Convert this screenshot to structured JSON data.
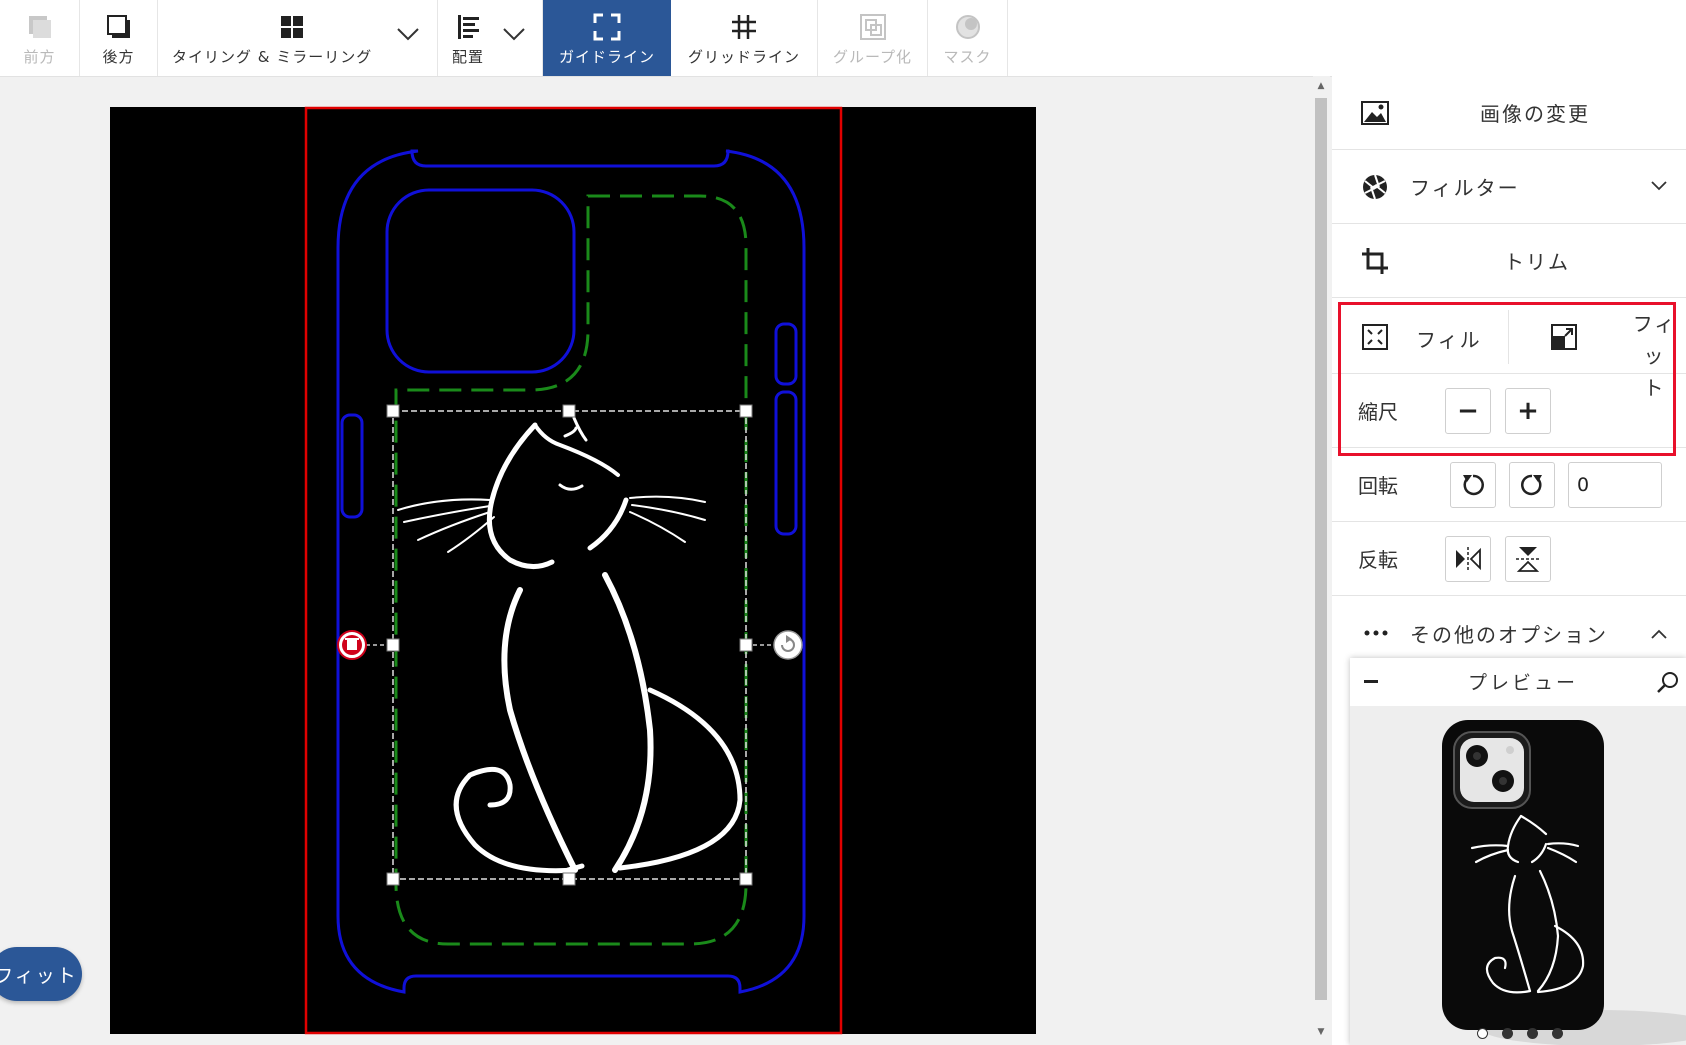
{
  "toolbar": {
    "undo_label": "前方",
    "redo_label": "後方",
    "tiling_label": "タイリング & ミラーリング",
    "arrange_label": "配置",
    "guideline_label": "ガイドライン",
    "gridline_label": "グリッドライン",
    "group_label": "グループ化",
    "mask_label": "マスク"
  },
  "canvas": {
    "fit_button_label": "フィット"
  },
  "panel": {
    "change_image_label": "画像の変更",
    "filter_label": "フィルター",
    "trim_label": "トリム",
    "fill_label": "フィル",
    "fit_label_line1": "フィッ",
    "fit_label_line2": "ト",
    "scale_label": "縮尺",
    "rotate_label": "回転",
    "rotate_value": "0",
    "flip_label": "反転",
    "more_options_label": "その他のオプション",
    "preview_title": "プレビュー"
  },
  "colors": {
    "accent": "#2b5797",
    "highlight": "#e8102b",
    "safe_area": "#e00000",
    "phone_outline": "#1010d8",
    "guide_dashed": "#1a8a1a"
  },
  "icons": [
    "undo-icon",
    "redo-icon",
    "tiling-icon",
    "arrange-icon",
    "guideline-icon",
    "gridline-icon",
    "group-icon",
    "mask-icon",
    "image-icon",
    "filter-icon",
    "crop-icon",
    "fill-icon",
    "fit-icon",
    "zoom-icon"
  ]
}
